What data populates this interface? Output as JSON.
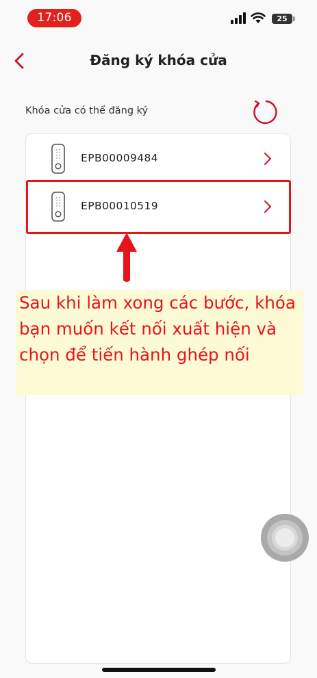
{
  "status_bar": {
    "time": "17:06",
    "battery": "25"
  },
  "header": {
    "title": "Đăng ký khóa cửa"
  },
  "section": {
    "label": "Khóa cửa có thể đăng ký"
  },
  "devices": [
    {
      "id": "EPB00009484"
    },
    {
      "id": "EPB00010519"
    }
  ],
  "annotation": {
    "text": "Sau khi làm xong các bước, khóa bạn muốn kết nối xuất hiện và chọn để tiến hành ghép nối"
  },
  "colors": {
    "accent": "#c8102e",
    "annotation_red": "#e8141b",
    "annotation_bg": "#fdfbd6"
  }
}
